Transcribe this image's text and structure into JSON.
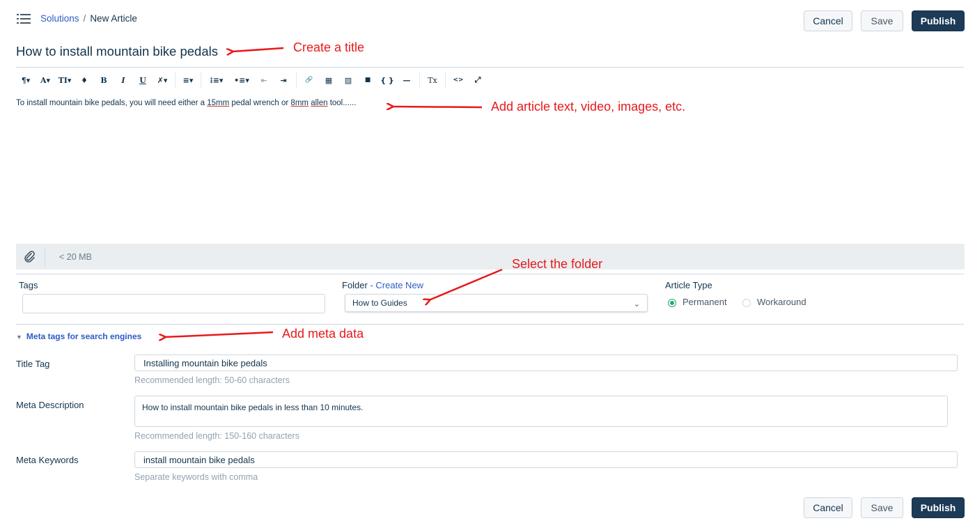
{
  "breadcrumb": {
    "parent": "Solutions",
    "separator": "/",
    "current": "New Article"
  },
  "actions": {
    "cancel": "Cancel",
    "save": "Save",
    "publish": "Publish"
  },
  "article": {
    "title": "How to install mountain bike pedals",
    "body_prefix": "To install mountain bike pedals, you will need either a ",
    "body_word1": "15mm",
    "body_mid": " pedal wrench or ",
    "body_word2": "8mm",
    "body_word3": "allen",
    "body_suffix": " tool......"
  },
  "toolbar": {
    "items": [
      "¶▾",
      "A▾",
      "TI▾",
      "♦",
      "B",
      "I",
      "U",
      "✗▾",
      "≡▾",
      "⁝≡▾",
      "•≡▾",
      "⇤",
      "⇥",
      "🔗",
      "▦",
      "▨",
      "■",
      "{ }",
      "—",
      "Tx",
      "<>",
      "⤢"
    ],
    "icons": [
      "paragraph-format-icon",
      "font-size-icon",
      "text-style-icon",
      "text-color-icon",
      "bold-icon",
      "italic-icon",
      "underline-icon",
      "clear-format-icon",
      "align-icon",
      "ordered-list-icon",
      "unordered-list-icon",
      "outdent-icon",
      "indent-icon",
      "link-icon",
      "table-icon",
      "image-icon",
      "video-icon",
      "code-snippet-icon",
      "horizontal-rule-icon",
      "remove-format-icon",
      "html-view-icon",
      "fullscreen-icon"
    ]
  },
  "attachment": {
    "icon": "paperclip-icon",
    "size_limit": "< 20 MB"
  },
  "tags": {
    "label": "Tags",
    "value": ""
  },
  "folder": {
    "label": "Folder",
    "dash": " - ",
    "create_new": "Create New",
    "selected": "How to Guides"
  },
  "article_type": {
    "label": "Article Type",
    "options": [
      "Permanent",
      "Workaround"
    ],
    "selected": "Permanent"
  },
  "meta": {
    "toggle_label": "Meta tags for search engines",
    "title_tag": {
      "label": "Title Tag",
      "value": "Installing mountain bike pedals",
      "help": "Recommended length: 50-60 characters"
    },
    "description": {
      "label": "Meta Description",
      "value": "How to install mountain bike pedals in less than 10 minutes.",
      "help": "Recommended length: 150-160 characters"
    },
    "keywords": {
      "label": "Meta Keywords",
      "value": "install mountain bike pedals",
      "help": "Separate keywords with comma"
    }
  },
  "annotations": {
    "title": "Create a title",
    "text": "Add article text, video, images, etc.",
    "folder": "Select the folder",
    "meta": "Add meta data"
  },
  "colors": {
    "accent": "#2c5cc5",
    "primary_button": "#1d3a57",
    "annotation": "#e8191b",
    "radio_on": "#26a96c"
  }
}
